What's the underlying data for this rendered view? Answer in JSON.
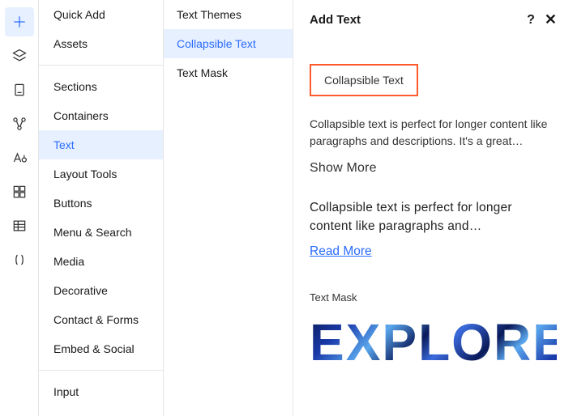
{
  "iconbar": {
    "items": [
      {
        "name": "add-icon"
      },
      {
        "name": "layers-icon"
      },
      {
        "name": "page-icon"
      },
      {
        "name": "connections-icon"
      },
      {
        "name": "typography-icon"
      },
      {
        "name": "grid-icon"
      },
      {
        "name": "table-icon"
      },
      {
        "name": "code-icon"
      }
    ]
  },
  "categories": {
    "group1": [
      {
        "label": "Quick Add"
      },
      {
        "label": "Assets"
      }
    ],
    "group2": [
      {
        "label": "Sections"
      },
      {
        "label": "Containers"
      },
      {
        "label": "Text",
        "active": true
      },
      {
        "label": "Layout Tools"
      },
      {
        "label": "Buttons"
      },
      {
        "label": "Menu & Search"
      },
      {
        "label": "Media"
      },
      {
        "label": "Decorative"
      },
      {
        "label": "Contact & Forms"
      },
      {
        "label": "Embed & Social"
      }
    ],
    "group3": [
      {
        "label": "Input"
      }
    ]
  },
  "subitems": [
    {
      "label": "Text Themes"
    },
    {
      "label": "Collapsible Text",
      "active": true
    },
    {
      "label": "Text Mask"
    }
  ],
  "detail": {
    "title": "Add Text",
    "highlight": "Collapsible Text",
    "desc1": "Collapsible text is perfect for longer content like paragraphs and descriptions. It's a great…",
    "showmore": "Show More",
    "desc2": "Collapsible text is perfect for longer content like paragraphs and…",
    "readmore": "Read More",
    "textmask_label": "Text Mask",
    "explore": "EXPLORE"
  }
}
